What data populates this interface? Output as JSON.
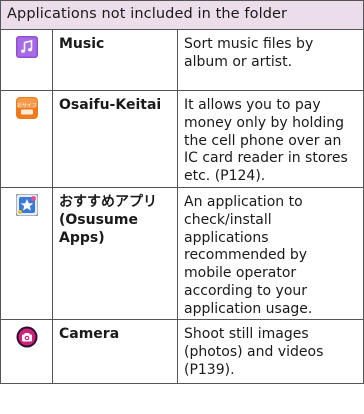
{
  "table": {
    "header": "Applications not included in the folder",
    "rows": [
      {
        "icon": "music-app-icon",
        "name": "Music",
        "description": "Sort music files by album or artist."
      },
      {
        "icon": "osaifu-keitai-app-icon",
        "icon_text": "おサイフ",
        "name": "Osaifu-Keitai",
        "description": "It allows you to pay money only by holding the cell phone over an IC card reader in stores etc. (P124)."
      },
      {
        "icon": "osusume-apps-icon",
        "name": "おすすめアプリ(Osusume Apps)",
        "description": "An application to check/install applications recommended by mobile operator according to your application usage."
      },
      {
        "icon": "camera-app-icon",
        "name": "Camera",
        "description": "Shoot still images (photos) and videos (P139)."
      }
    ]
  },
  "colors": {
    "header_bg": "#ecddea",
    "border": "#555555",
    "music": "#8e4fd6",
    "osaifu": "#f07a18",
    "osusume": "#3a7ad6",
    "camera": "#d0207a"
  }
}
